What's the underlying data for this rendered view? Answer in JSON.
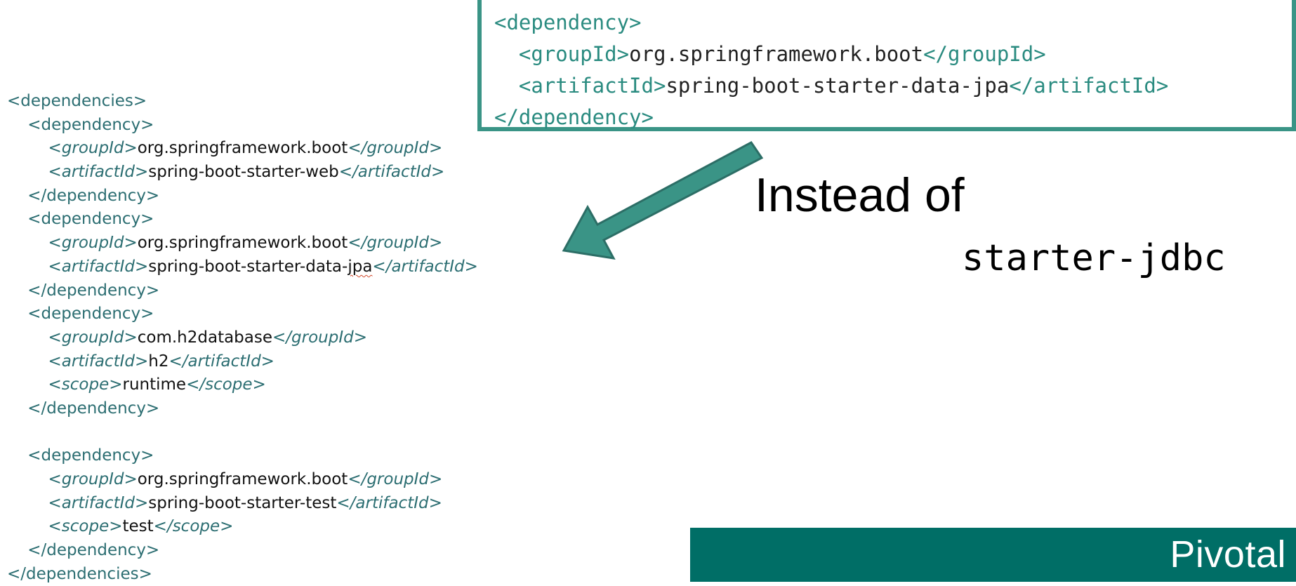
{
  "main_code": {
    "lines": [
      {
        "indent": "",
        "parts": [
          {
            "t": "<dependencies>",
            "c": "tag"
          }
        ]
      },
      {
        "indent": "    ",
        "parts": [
          {
            "t": "<dependency>",
            "c": "tag"
          }
        ]
      },
      {
        "indent": "        ",
        "parts": [
          {
            "t": "<groupId>",
            "c": "itag"
          },
          {
            "t": "org.springframework.boot",
            "c": "val"
          },
          {
            "t": "</groupId>",
            "c": "itag"
          }
        ]
      },
      {
        "indent": "        ",
        "parts": [
          {
            "t": "<artifactId>",
            "c": "itag"
          },
          {
            "t": "spring-boot-starter-web",
            "c": "val"
          },
          {
            "t": "</artifactId>",
            "c": "itag"
          }
        ]
      },
      {
        "indent": "    ",
        "parts": [
          {
            "t": "</dependency>",
            "c": "tag"
          }
        ]
      },
      {
        "indent": "    ",
        "parts": [
          {
            "t": "<dependency>",
            "c": "tag"
          }
        ]
      },
      {
        "indent": "        ",
        "parts": [
          {
            "t": "<groupId>",
            "c": "itag"
          },
          {
            "t": "org.springframework.boot",
            "c": "val"
          },
          {
            "t": "</groupId>",
            "c": "itag"
          }
        ]
      },
      {
        "indent": "        ",
        "parts": [
          {
            "t": "<artifactId>",
            "c": "itag"
          },
          {
            "t": "spring-boot-starter-data-",
            "c": "val"
          },
          {
            "t": "jpa",
            "c": "val squig"
          },
          {
            "t": "</artifactId>",
            "c": "itag"
          }
        ]
      },
      {
        "indent": "    ",
        "parts": [
          {
            "t": "</dependency>",
            "c": "tag"
          }
        ]
      },
      {
        "indent": "    ",
        "parts": [
          {
            "t": "<dependency>",
            "c": "tag"
          }
        ]
      },
      {
        "indent": "        ",
        "parts": [
          {
            "t": "<groupId>",
            "c": "itag"
          },
          {
            "t": "com.h2database",
            "c": "val"
          },
          {
            "t": "</groupId>",
            "c": "itag"
          }
        ]
      },
      {
        "indent": "        ",
        "parts": [
          {
            "t": "<artifactId>",
            "c": "itag"
          },
          {
            "t": "h2",
            "c": "val"
          },
          {
            "t": "</artifactId>",
            "c": "itag"
          }
        ]
      },
      {
        "indent": "        ",
        "parts": [
          {
            "t": "<scope>",
            "c": "itag"
          },
          {
            "t": "runtime",
            "c": "val"
          },
          {
            "t": "</scope>",
            "c": "itag"
          }
        ]
      },
      {
        "indent": "    ",
        "parts": [
          {
            "t": "</dependency>",
            "c": "tag"
          }
        ]
      },
      {
        "indent": "",
        "parts": []
      },
      {
        "indent": "    ",
        "parts": [
          {
            "t": "<dependency>",
            "c": "tag"
          }
        ]
      },
      {
        "indent": "        ",
        "parts": [
          {
            "t": "<groupId>",
            "c": "itag"
          },
          {
            "t": "org.springframework.boot",
            "c": "val"
          },
          {
            "t": "</groupId>",
            "c": "itag"
          }
        ]
      },
      {
        "indent": "        ",
        "parts": [
          {
            "t": "<artifactId>",
            "c": "itag"
          },
          {
            "t": "spring-boot-starter-test",
            "c": "val"
          },
          {
            "t": "</artifactId>",
            "c": "itag"
          }
        ]
      },
      {
        "indent": "        ",
        "parts": [
          {
            "t": "<scope>",
            "c": "itag"
          },
          {
            "t": "test",
            "c": "val"
          },
          {
            "t": "</scope>",
            "c": "itag"
          }
        ]
      },
      {
        "indent": "    ",
        "parts": [
          {
            "t": "</dependency>",
            "c": "tag"
          }
        ]
      },
      {
        "indent": "",
        "parts": [
          {
            "t": "</dependencies>",
            "c": "tag"
          }
        ]
      }
    ]
  },
  "callout": {
    "lines": [
      {
        "indent": "",
        "parts": [
          {
            "t": "<dependency>",
            "c": "tag"
          }
        ]
      },
      {
        "indent": "  ",
        "parts": [
          {
            "t": "<groupId>",
            "c": "tag"
          },
          {
            "t": "org.springframework.boot",
            "c": "val"
          },
          {
            "t": "</groupId>",
            "c": "tag"
          }
        ]
      },
      {
        "indent": "  ",
        "parts": [
          {
            "t": "<artifactId>",
            "c": "tag"
          },
          {
            "t": "spring-boot-starter-data-jpa",
            "c": "val"
          },
          {
            "t": "</artifactId>",
            "c": "tag"
          }
        ]
      },
      {
        "indent": "",
        "parts": [
          {
            "t": "</dependency>",
            "c": "tag"
          }
        ]
      }
    ]
  },
  "note": {
    "instead_of": "Instead of",
    "replaced": "starter-jdbc"
  },
  "footer": {
    "brand": "Pivotal"
  },
  "colors": {
    "accent": "#3a9486",
    "footer_bg": "#006e66",
    "tag": "#2c6e72"
  }
}
